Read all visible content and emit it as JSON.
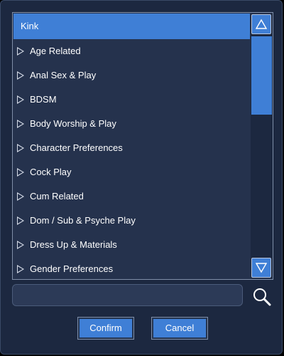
{
  "list": {
    "header": "Kink",
    "items": [
      "Age Related",
      "Anal Sex & Play",
      "BDSM",
      "Body Worship & Play",
      "Character Preferences",
      "Cock Play",
      "Cum Related",
      "Dom / Sub & Psyche Play",
      "Dress Up & Materials",
      "Gender Preferences"
    ]
  },
  "search": {
    "value": "",
    "placeholder": ""
  },
  "buttons": {
    "confirm": "Confirm",
    "cancel": "Cancel"
  },
  "icons": {
    "scroll_up": "triangle-up-icon",
    "scroll_down": "triangle-down-icon",
    "expand": "triangle-right-outline-icon",
    "search": "magnifier-icon"
  },
  "colors": {
    "accent": "#3f7fd6",
    "background": "#1c2840",
    "list_background": "#25324d"
  }
}
